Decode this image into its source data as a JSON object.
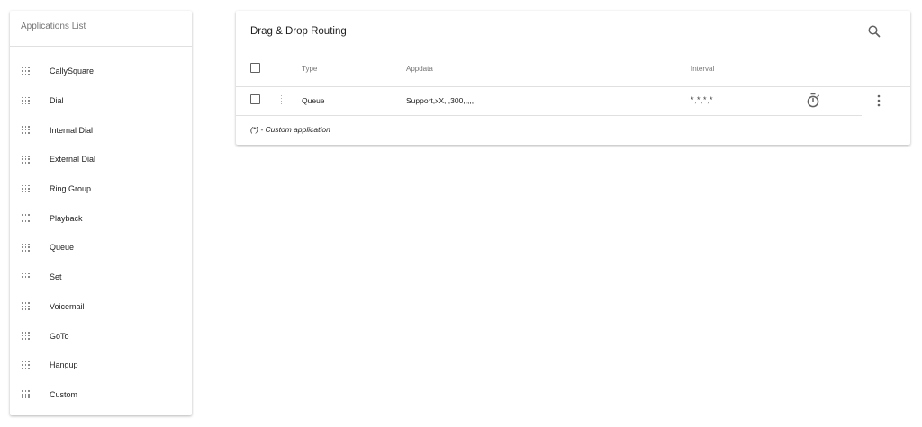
{
  "applications": {
    "title": "Applications List",
    "items": [
      {
        "label": "CallySquare"
      },
      {
        "label": "Dial"
      },
      {
        "label": "Internal Dial"
      },
      {
        "label": "External Dial"
      },
      {
        "label": "Ring Group"
      },
      {
        "label": "Playback"
      },
      {
        "label": "Queue"
      },
      {
        "label": "Set"
      },
      {
        "label": "Voicemail"
      },
      {
        "label": "GoTo"
      },
      {
        "label": "Hangup"
      },
      {
        "label": "Custom"
      }
    ]
  },
  "routing": {
    "title": "Drag & Drop Routing",
    "columns": {
      "type": "Type",
      "appdata": "Appdata",
      "interval": "Interval"
    },
    "rows": [
      {
        "type": "Queue",
        "appdata": "Support,xX,,,300,,,,,",
        "interval": "*,*,*,*"
      }
    ],
    "footnote": "(*) - Custom application"
  },
  "icons": {
    "search": "search-icon",
    "drag": "drag-indicator-icon",
    "timer": "timer-icon",
    "more": "more-vert-icon"
  }
}
